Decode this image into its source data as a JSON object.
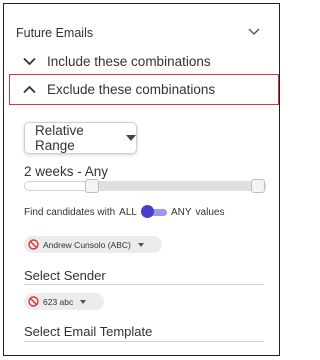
{
  "panel": {
    "title": "Future Emails",
    "include_label": "Include these combinations",
    "exclude_label": "Exclude these combinations"
  },
  "range": {
    "button_label": "Relative Range",
    "value_label": "2 weeks - Any",
    "slider_low_fraction": 0.27,
    "slider_high_fraction": 1.0
  },
  "match": {
    "prefix": "Find candidates with",
    "all_label": "ALL",
    "any_label": "ANY",
    "suffix": "values",
    "selected": "ANY"
  },
  "exclusions": {
    "sender_chip": "Andrew Cunsolo (ABC)",
    "sender_label": "Select Sender",
    "template_chip": "623 abc",
    "template_label": "Select Email Template"
  },
  "colors": {
    "highlight_border": "#d9343a",
    "toggle_accent": "#4a3ccf",
    "ban_icon": "#d9343a"
  },
  "icons": {
    "header": "chevron-down-icon",
    "include": "chevron-down-icon",
    "exclude": "chevron-up-icon",
    "chip": "ban-icon"
  }
}
